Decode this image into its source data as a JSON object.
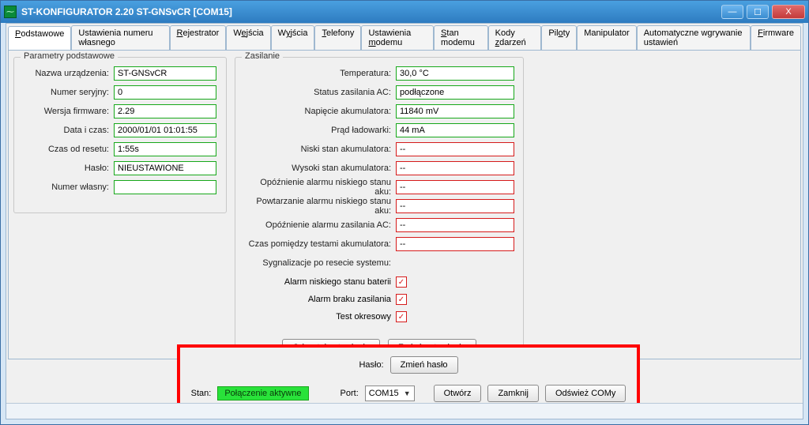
{
  "window": {
    "title": "ST-KONFIGURATOR 2.20 ST-GNSvCR   [COM15]",
    "min": "—",
    "max": "☐",
    "close": "X"
  },
  "tabs": [
    "Podstawowe",
    "Ustawienia numeru własnego",
    "Rejestrator",
    "Wejścia",
    "Wyjścia",
    "Telefony",
    "Ustawienia modemu",
    "Stan modemu",
    "Kody zdarzeń",
    "Piloty",
    "Manipulator",
    "Automatyczne wgrywanie ustawień",
    "Firmware"
  ],
  "params": {
    "legend": "Parametry podstawowe",
    "rows": [
      {
        "label": "Nazwa urządzenia:",
        "value": "ST-GNSvCR"
      },
      {
        "label": "Numer seryjny:",
        "value": "0"
      },
      {
        "label": "Wersja firmware:",
        "value": "2.29"
      },
      {
        "label": "Data i czas:",
        "value": "2000/01/01 01:01:55"
      },
      {
        "label": "Czas od resetu:",
        "value": "1:55s"
      },
      {
        "label": "Hasło:",
        "value": "NIEUSTAWIONE"
      },
      {
        "label": "Numer własny:",
        "value": ""
      }
    ]
  },
  "power": {
    "legend": "Zasilanie",
    "green_rows": [
      {
        "label": "Temperatura:",
        "value": "30,0 °C"
      },
      {
        "label": "Status zasilania AC:",
        "value": "podłączone"
      },
      {
        "label": "Napięcie akumulatora:",
        "value": "11840 mV"
      },
      {
        "label": "Prąd ładowarki:",
        "value": "44 mA"
      }
    ],
    "red_rows": [
      {
        "label": "Niski stan akumulatora:",
        "value": "--"
      },
      {
        "label": "Wysoki stan akumulatora:",
        "value": "--"
      },
      {
        "label": "Opóźnienie alarmu niskiego stanu aku:",
        "value": "--"
      },
      {
        "label": "Powtarzanie alarmu niskiego stanu aku:",
        "value": "--"
      },
      {
        "label": "Opóźnienie alarmu zasilania AC:",
        "value": "--"
      },
      {
        "label": "Czas pomiędzy testami akumulatora:",
        "value": "--"
      }
    ],
    "sig_header": "Sygnalizacje po resecie systemu:",
    "checks": [
      "Alarm niskiego stanu baterii",
      "Alarm braku zasilania",
      "Test okresowy"
    ],
    "btn_read": "Odczytaj ustawienia",
    "btn_write": "Zmień ustawienia"
  },
  "footer": {
    "haslo_label": "Hasło:",
    "btn_change_pw": "Zmień hasło",
    "stan_label": "Stan:",
    "stan_value": "Połączenie aktywne",
    "port_label": "Port:",
    "port_value": "COM15",
    "btn_open": "Otwórz",
    "btn_close": "Zamknij",
    "btn_refresh": "Odśwież COMy"
  }
}
